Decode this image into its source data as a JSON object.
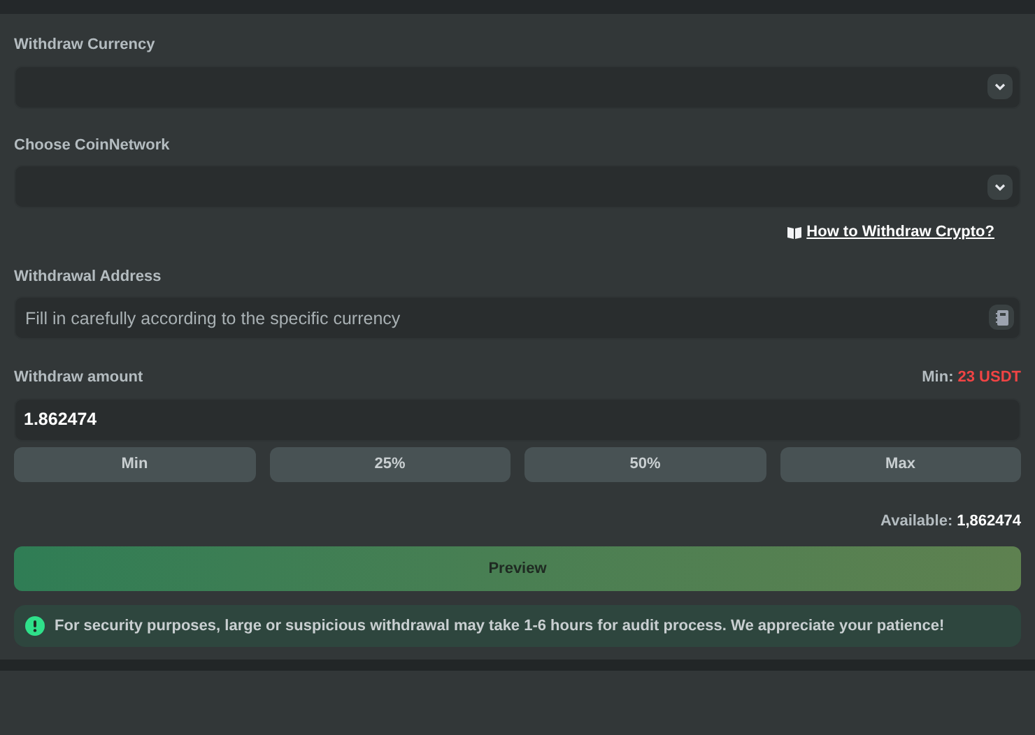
{
  "currency": {
    "label": "Withdraw Currency"
  },
  "network": {
    "label": "Choose CoinNetwork"
  },
  "help_link": "How to Withdraw Crypto?",
  "address": {
    "label": "Withdrawal Address",
    "placeholder": "Fill in carefully according to the specific currency"
  },
  "amount": {
    "label": "Withdraw amount",
    "min_label": "Min:",
    "min_value": "23 USDT",
    "value": "1.862474"
  },
  "quick_buttons": [
    "Min",
    "25%",
    "50%",
    "Max"
  ],
  "available": {
    "label": "Available:",
    "value": "1,862474"
  },
  "preview_button": "Preview",
  "notice": "For security purposes, large or suspicious withdrawal may take 1-6 hours for audit process. We appreciate your patience!"
}
